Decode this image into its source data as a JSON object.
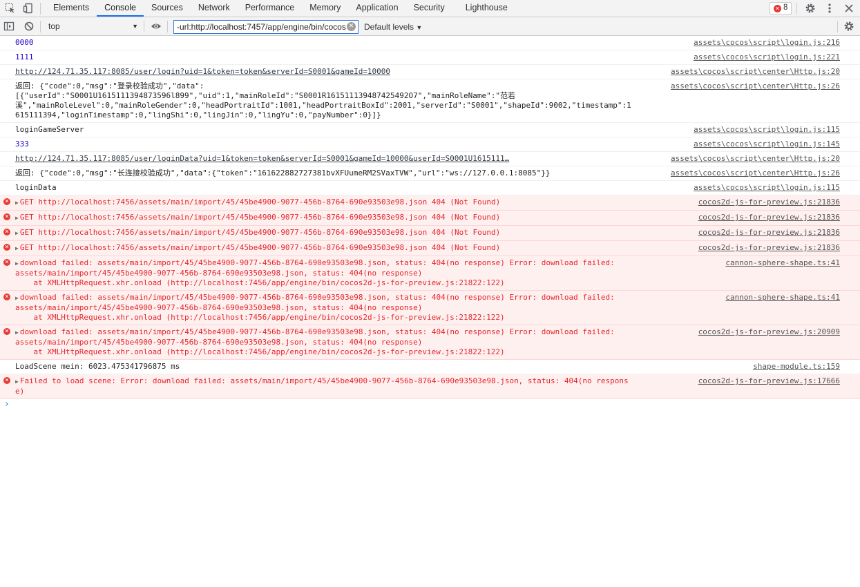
{
  "tabs": [
    "Elements",
    "Console",
    "Sources",
    "Network",
    "Performance",
    "Memory",
    "Application",
    "Security",
    "Lighthouse"
  ],
  "selected_tab": "Console",
  "error_count": "8",
  "toolbar": {
    "context": "top",
    "filter_value": "-url:http://localhost:7457/app/engine/bin/cocos",
    "levels": "Default levels"
  },
  "colors": {
    "accent": "#1a73e8",
    "error_text": "#e3262c",
    "error_bg": "#fff0f0"
  },
  "messages": [
    {
      "type": "log",
      "text": "0000",
      "source": "assets\\cocos\\script\\login.js:216"
    },
    {
      "type": "log",
      "text": "1111",
      "source": "assets\\cocos\\script\\login.js:221"
    },
    {
      "type": "log",
      "text": "http://124.71.35.117:8085/user/login?uid=1&token=token&serverId=S0001&gameId=10000",
      "source": "assets\\cocos\\script\\center\\Http.js:20"
    },
    {
      "type": "log",
      "text": "返回: {\"code\":0,\"msg\":\"登录校验成功\",\"data\":\n[{\"userId\":\"S0001U1615111394873596l899\",\"uid\":1,\"mainRoleId\":\"S0001R161511139487425492O7\",\"mainRoleName\":\"范若\n溪\",\"mainRoleLevel\":0,\"mainRoleGender\":0,\"headPortraitId\":1001,\"headPortraitBoxId\":2001,\"serverId\":\"S0001\",\"shapeId\":9002,\"timestamp\":1615111394,\"loginTimestamp\":0,\"lingShi\":0,\"lingJin\":0,\"lingYu\":0,\"payNumber\":0}]}",
      "source": "assets\\cocos\\script\\center\\Http.js:26"
    },
    {
      "type": "log",
      "text": "loginGameServer",
      "source": "assets\\cocos\\script\\login.js:115"
    },
    {
      "type": "log",
      "text": "333",
      "source": "assets\\cocos\\script\\login.js:145"
    },
    {
      "type": "log",
      "text": "http://124.71.35.117:8085/user/loginData?uid=1&token=token&serverId=S0001&gameId=10000&userId=S0001U1615111…",
      "source": "assets\\cocos\\script\\center\\Http.js:20"
    },
    {
      "type": "log",
      "text": "返回: {\"code\":0,\"msg\":\"长连接校验成功\",\"data\":{\"token\":\"161622882727381bvXFUumeRM2SVaxTVW\",\"url\":\"ws://127.0.0.1:8085\"}}",
      "source": "assets\\cocos\\script\\center\\Http.js:26"
    },
    {
      "type": "log",
      "text": "loginData",
      "source": "assets\\cocos\\script\\login.js:115"
    },
    {
      "type": "error",
      "text": "GET http://localhost:7456/assets/main/import/45/45be4900-9077-456b-8764-690e93503e98.json 404 (Not Found)",
      "source": "cocos2d-js-for-preview.js:21836"
    },
    {
      "type": "error",
      "text": "GET http://localhost:7456/assets/main/import/45/45be4900-9077-456b-8764-690e93503e98.json 404 (Not Found)",
      "source": "cocos2d-js-for-preview.js:21836"
    },
    {
      "type": "error",
      "text": "GET http://localhost:7456/assets/main/import/45/45be4900-9077-456b-8764-690e93503e98.json 404 (Not Found)",
      "source": "cocos2d-js-for-preview.js:21836"
    },
    {
      "type": "error",
      "text": "GET http://localhost:7456/assets/main/import/45/45be4900-9077-456b-8764-690e93503e98.json 404 (Not Found)",
      "source": "cocos2d-js-for-preview.js:21836"
    },
    {
      "type": "error",
      "text": "download failed: assets/main/import/45/45be4900-9077-456b-8764-690e93503e98.json, status: 404(no response) Error: download failed:\nassets/main/import/45/45be4900-9077-456b-8764-690e93503e98.json, status: 404(no response)\n    at XMLHttpRequest.xhr.onload (http://localhost:7456/app/engine/bin/cocos2d-js-for-preview.js:21822:122)",
      "source": "cannon-sphere-shape.ts:41"
    },
    {
      "type": "error",
      "text": "download failed: assets/main/import/45/45be4900-9077-456b-8764-690e93503e98.json, status: 404(no response) Error: download failed:\nassets/main/import/45/45be4900-9077-456b-8764-690e93503e98.json, status: 404(no response)\n    at XMLHttpRequest.xhr.onload (http://localhost:7456/app/engine/bin/cocos2d-js-for-preview.js:21822:122)",
      "source": "cannon-sphere-shape.ts:41"
    },
    {
      "type": "error",
      "text": "download failed: assets/main/import/45/45be4900-9077-456b-8764-690e93503e98.json, status: 404(no response) Error: download failed:\nassets/main/import/45/45be4900-9077-456b-8764-690e93503e98.json, status: 404(no response)\n    at XMLHttpRequest.xhr.onload (http://localhost:7456/app/engine/bin/cocos2d-js-for-preview.js:21822:122)",
      "source": "cocos2d-js-for-preview.js:20909"
    },
    {
      "type": "log",
      "text": "LoadScene mein: 6023.475341796875 ms",
      "source": "shape-module.ts:159"
    },
    {
      "type": "error",
      "text": "Failed to load scene: Error: download failed: assets/main/import/45/45be4900-9077-456b-8764-690e93503e98.json, status: 404(no response)",
      "source": "cocos2d-js-for-preview.js:17666"
    }
  ]
}
